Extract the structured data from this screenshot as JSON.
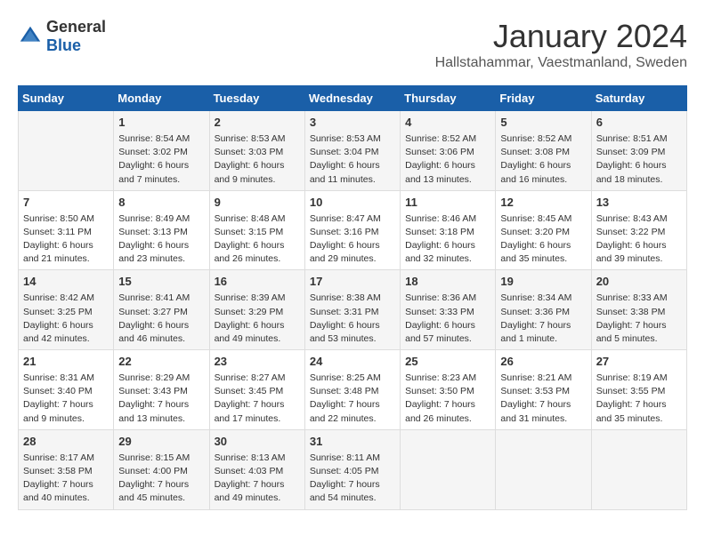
{
  "header": {
    "logo_general": "General",
    "logo_blue": "Blue",
    "month": "January 2024",
    "location": "Hallstahammar, Vaestmanland, Sweden"
  },
  "days_of_week": [
    "Sunday",
    "Monday",
    "Tuesday",
    "Wednesday",
    "Thursday",
    "Friday",
    "Saturday"
  ],
  "weeks": [
    [
      {
        "day": "",
        "info": ""
      },
      {
        "day": "1",
        "info": "Sunrise: 8:54 AM\nSunset: 3:02 PM\nDaylight: 6 hours\nand 7 minutes."
      },
      {
        "day": "2",
        "info": "Sunrise: 8:53 AM\nSunset: 3:03 PM\nDaylight: 6 hours\nand 9 minutes."
      },
      {
        "day": "3",
        "info": "Sunrise: 8:53 AM\nSunset: 3:04 PM\nDaylight: 6 hours\nand 11 minutes."
      },
      {
        "day": "4",
        "info": "Sunrise: 8:52 AM\nSunset: 3:06 PM\nDaylight: 6 hours\nand 13 minutes."
      },
      {
        "day": "5",
        "info": "Sunrise: 8:52 AM\nSunset: 3:08 PM\nDaylight: 6 hours\nand 16 minutes."
      },
      {
        "day": "6",
        "info": "Sunrise: 8:51 AM\nSunset: 3:09 PM\nDaylight: 6 hours\nand 18 minutes."
      }
    ],
    [
      {
        "day": "7",
        "info": "Sunrise: 8:50 AM\nSunset: 3:11 PM\nDaylight: 6 hours\nand 21 minutes."
      },
      {
        "day": "8",
        "info": "Sunrise: 8:49 AM\nSunset: 3:13 PM\nDaylight: 6 hours\nand 23 minutes."
      },
      {
        "day": "9",
        "info": "Sunrise: 8:48 AM\nSunset: 3:15 PM\nDaylight: 6 hours\nand 26 minutes."
      },
      {
        "day": "10",
        "info": "Sunrise: 8:47 AM\nSunset: 3:16 PM\nDaylight: 6 hours\nand 29 minutes."
      },
      {
        "day": "11",
        "info": "Sunrise: 8:46 AM\nSunset: 3:18 PM\nDaylight: 6 hours\nand 32 minutes."
      },
      {
        "day": "12",
        "info": "Sunrise: 8:45 AM\nSunset: 3:20 PM\nDaylight: 6 hours\nand 35 minutes."
      },
      {
        "day": "13",
        "info": "Sunrise: 8:43 AM\nSunset: 3:22 PM\nDaylight: 6 hours\nand 39 minutes."
      }
    ],
    [
      {
        "day": "14",
        "info": "Sunrise: 8:42 AM\nSunset: 3:25 PM\nDaylight: 6 hours\nand 42 minutes."
      },
      {
        "day": "15",
        "info": "Sunrise: 8:41 AM\nSunset: 3:27 PM\nDaylight: 6 hours\nand 46 minutes."
      },
      {
        "day": "16",
        "info": "Sunrise: 8:39 AM\nSunset: 3:29 PM\nDaylight: 6 hours\nand 49 minutes."
      },
      {
        "day": "17",
        "info": "Sunrise: 8:38 AM\nSunset: 3:31 PM\nDaylight: 6 hours\nand 53 minutes."
      },
      {
        "day": "18",
        "info": "Sunrise: 8:36 AM\nSunset: 3:33 PM\nDaylight: 6 hours\nand 57 minutes."
      },
      {
        "day": "19",
        "info": "Sunrise: 8:34 AM\nSunset: 3:36 PM\nDaylight: 7 hours\nand 1 minute."
      },
      {
        "day": "20",
        "info": "Sunrise: 8:33 AM\nSunset: 3:38 PM\nDaylight: 7 hours\nand 5 minutes."
      }
    ],
    [
      {
        "day": "21",
        "info": "Sunrise: 8:31 AM\nSunset: 3:40 PM\nDaylight: 7 hours\nand 9 minutes."
      },
      {
        "day": "22",
        "info": "Sunrise: 8:29 AM\nSunset: 3:43 PM\nDaylight: 7 hours\nand 13 minutes."
      },
      {
        "day": "23",
        "info": "Sunrise: 8:27 AM\nSunset: 3:45 PM\nDaylight: 7 hours\nand 17 minutes."
      },
      {
        "day": "24",
        "info": "Sunrise: 8:25 AM\nSunset: 3:48 PM\nDaylight: 7 hours\nand 22 minutes."
      },
      {
        "day": "25",
        "info": "Sunrise: 8:23 AM\nSunset: 3:50 PM\nDaylight: 7 hours\nand 26 minutes."
      },
      {
        "day": "26",
        "info": "Sunrise: 8:21 AM\nSunset: 3:53 PM\nDaylight: 7 hours\nand 31 minutes."
      },
      {
        "day": "27",
        "info": "Sunrise: 8:19 AM\nSunset: 3:55 PM\nDaylight: 7 hours\nand 35 minutes."
      }
    ],
    [
      {
        "day": "28",
        "info": "Sunrise: 8:17 AM\nSunset: 3:58 PM\nDaylight: 7 hours\nand 40 minutes."
      },
      {
        "day": "29",
        "info": "Sunrise: 8:15 AM\nSunset: 4:00 PM\nDaylight: 7 hours\nand 45 minutes."
      },
      {
        "day": "30",
        "info": "Sunrise: 8:13 AM\nSunset: 4:03 PM\nDaylight: 7 hours\nand 49 minutes."
      },
      {
        "day": "31",
        "info": "Sunrise: 8:11 AM\nSunset: 4:05 PM\nDaylight: 7 hours\nand 54 minutes."
      },
      {
        "day": "",
        "info": ""
      },
      {
        "day": "",
        "info": ""
      },
      {
        "day": "",
        "info": ""
      }
    ]
  ]
}
